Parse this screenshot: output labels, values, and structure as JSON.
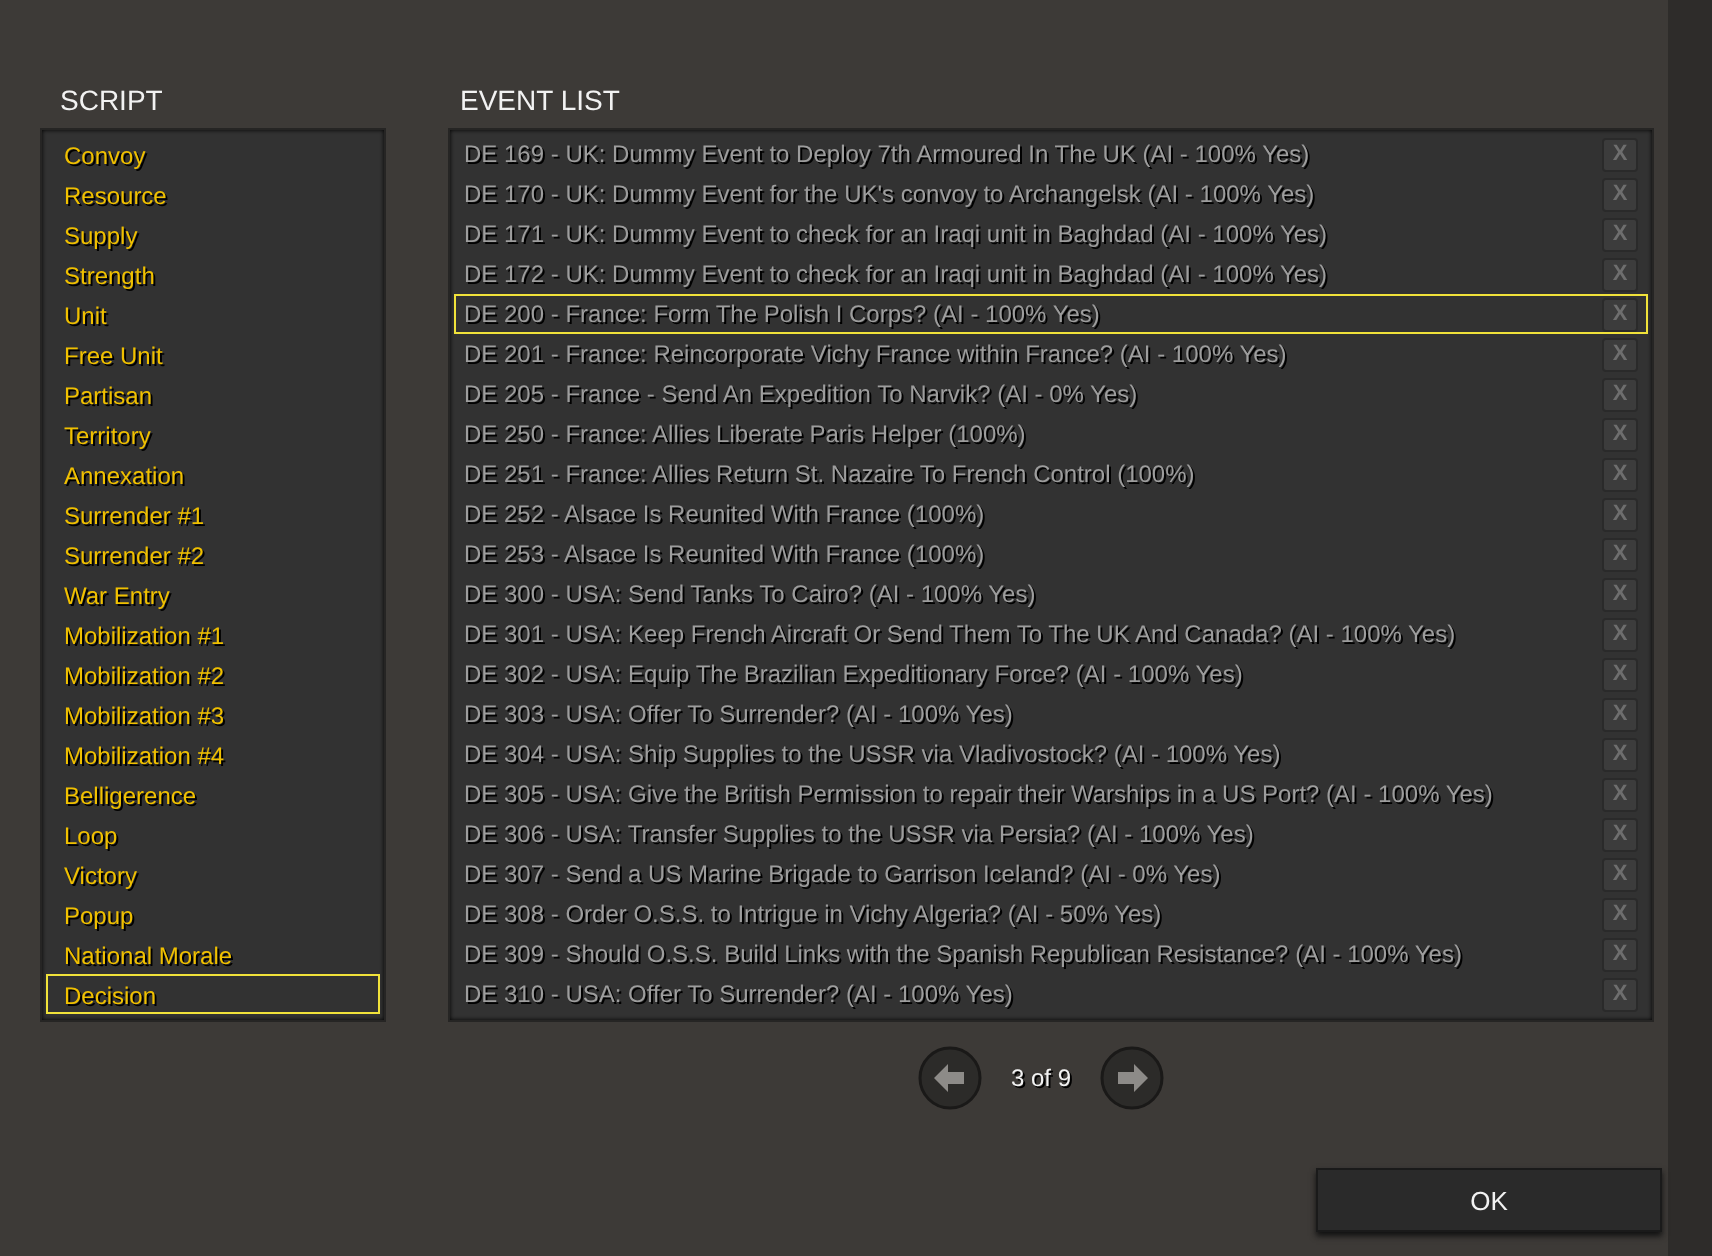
{
  "script": {
    "title": "SCRIPT",
    "items": [
      {
        "label": "Convoy",
        "selected": false
      },
      {
        "label": "Resource",
        "selected": false
      },
      {
        "label": "Supply",
        "selected": false
      },
      {
        "label": "Strength",
        "selected": false
      },
      {
        "label": "Unit",
        "selected": false
      },
      {
        "label": "Free Unit",
        "selected": false
      },
      {
        "label": "Partisan",
        "selected": false
      },
      {
        "label": "Territory",
        "selected": false
      },
      {
        "label": "Annexation",
        "selected": false
      },
      {
        "label": "Surrender #1",
        "selected": false
      },
      {
        "label": "Surrender #2",
        "selected": false
      },
      {
        "label": "War Entry",
        "selected": false
      },
      {
        "label": "Mobilization #1",
        "selected": false
      },
      {
        "label": "Mobilization #2",
        "selected": false
      },
      {
        "label": "Mobilization #3",
        "selected": false
      },
      {
        "label": "Mobilization #4",
        "selected": false
      },
      {
        "label": "Belligerence",
        "selected": false
      },
      {
        "label": "Loop",
        "selected": false
      },
      {
        "label": "Victory",
        "selected": false
      },
      {
        "label": "Popup",
        "selected": false
      },
      {
        "label": "National Morale",
        "selected": false
      },
      {
        "label": "Decision",
        "selected": true
      }
    ]
  },
  "event_list": {
    "title": "EVENT LIST",
    "rows": [
      {
        "label": "DE 169 - UK: Dummy Event to Deploy 7th Armoured In The UK (AI - 100% Yes)",
        "remove": "X",
        "selected": false
      },
      {
        "label": "DE 170 - UK: Dummy Event for the UK's convoy to Archangelsk (AI - 100% Yes)",
        "remove": "X",
        "selected": false
      },
      {
        "label": "DE 171 - UK: Dummy Event to check for an Iraqi unit in Baghdad (AI - 100% Yes)",
        "remove": "X",
        "selected": false
      },
      {
        "label": "DE 172 - UK: Dummy Event to check for an Iraqi unit in Baghdad (AI - 100% Yes)",
        "remove": "X",
        "selected": false
      },
      {
        "label": "DE 200 - France: Form The Polish I Corps? (AI - 100% Yes)",
        "remove": "X",
        "selected": true
      },
      {
        "label": "DE 201 - France: Reincorporate Vichy France within France? (AI - 100% Yes)",
        "remove": "X",
        "selected": false
      },
      {
        "label": "DE 205 - France - Send An Expedition To Narvik? (AI - 0% Yes)",
        "remove": "X",
        "selected": false
      },
      {
        "label": "DE 250 - France: Allies Liberate Paris Helper (100%)",
        "remove": "X",
        "selected": false
      },
      {
        "label": "DE 251 - France: Allies Return St. Nazaire To French Control (100%)",
        "remove": "X",
        "selected": false
      },
      {
        "label": "DE 252 - Alsace Is Reunited With France (100%)",
        "remove": "X",
        "selected": false
      },
      {
        "label": "DE 253 - Alsace Is Reunited With France (100%)",
        "remove": "X",
        "selected": false
      },
      {
        "label": "DE 300 - USA: Send Tanks To Cairo? (AI - 100% Yes)",
        "remove": "X",
        "selected": false
      },
      {
        "label": "DE 301 - USA: Keep French Aircraft Or Send Them To The UK And Canada? (AI - 100% Yes)",
        "remove": "X",
        "selected": false
      },
      {
        "label": "DE 302 - USA: Equip The Brazilian Expeditionary Force? (AI - 100% Yes)",
        "remove": "X",
        "selected": false
      },
      {
        "label": "DE 303 - USA: Offer To Surrender? (AI - 100% Yes)",
        "remove": "X",
        "selected": false
      },
      {
        "label": "DE 304 - USA: Ship Supplies to the USSR via Vladivostock? (AI - 100% Yes)",
        "remove": "X",
        "selected": false
      },
      {
        "label": "DE 305 - USA: Give the British Permission to repair their Warships in a US Port? (AI - 100% Yes)",
        "remove": "X",
        "selected": false
      },
      {
        "label": "DE 306 - USA: Transfer Supplies to the USSR via Persia? (AI - 100% Yes)",
        "remove": "X",
        "selected": false
      },
      {
        "label": "DE 307 - Send a US Marine Brigade to Garrison Iceland? (AI - 0% Yes)",
        "remove": "X",
        "selected": false
      },
      {
        "label": "DE 308 - Order O.S.S. to Intrigue in Vichy Algeria? (AI - 50% Yes)",
        "remove": "X",
        "selected": false
      },
      {
        "label": "DE 309 - Should O.S.S. Build Links with the Spanish Republican Resistance? (AI - 100% Yes)",
        "remove": "X",
        "selected": false
      },
      {
        "label": "DE 310 - USA: Offer To Surrender? (AI - 100% Yes)",
        "remove": "X",
        "selected": false
      }
    ]
  },
  "pagination": {
    "page": "3 of 9"
  },
  "buttons": [
    "OK"
  ]
}
